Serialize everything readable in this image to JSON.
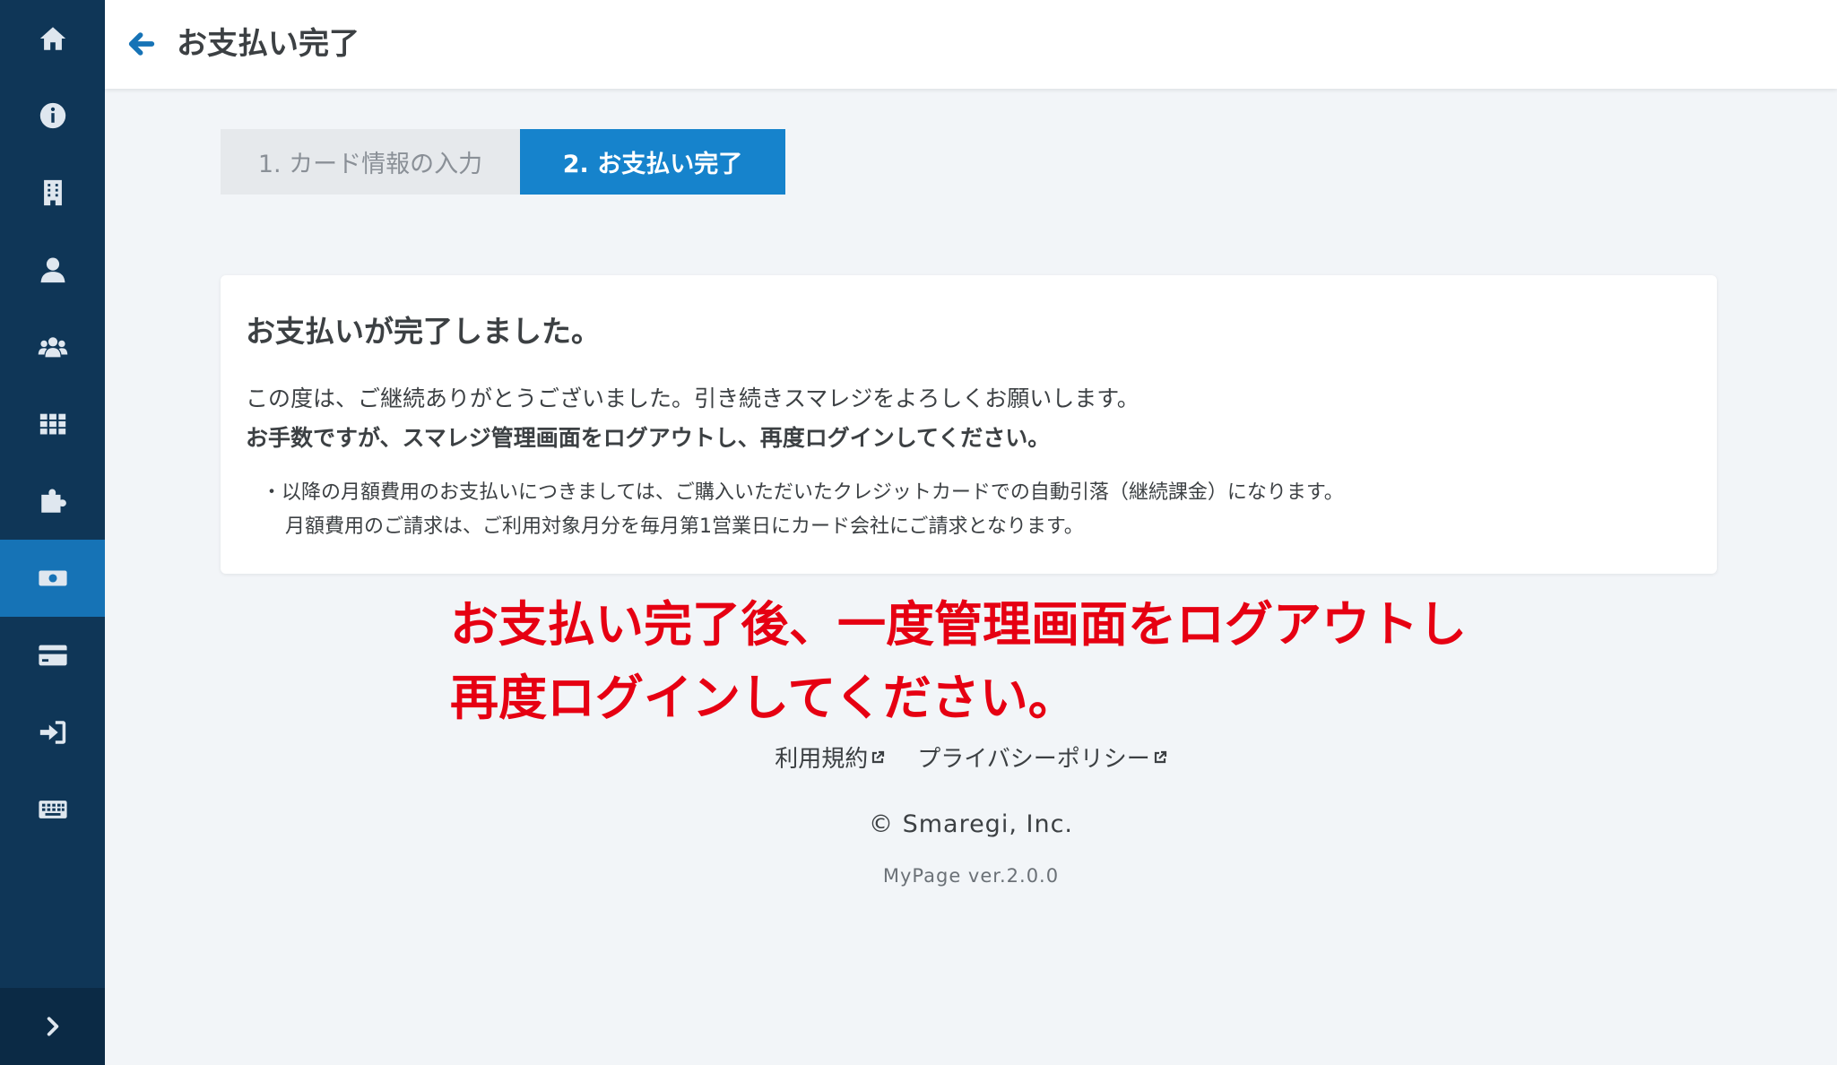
{
  "sidebar": {
    "items": [
      {
        "icon": "home-icon"
      },
      {
        "icon": "info-icon"
      },
      {
        "icon": "building-icon"
      },
      {
        "icon": "user-icon"
      },
      {
        "icon": "users-icon"
      },
      {
        "icon": "apps-grid-icon"
      },
      {
        "icon": "puzzle-icon"
      },
      {
        "icon": "money-icon",
        "active": true
      },
      {
        "icon": "credit-card-icon"
      },
      {
        "icon": "sign-in-icon"
      },
      {
        "icon": "keyboard-icon"
      }
    ],
    "expand_icon": "chevron-right-icon"
  },
  "header": {
    "title": "お支払い完了"
  },
  "steps": [
    {
      "label": "1. カード情報の入力",
      "active": false
    },
    {
      "label": "2. お支払い完了",
      "active": true
    }
  ],
  "card": {
    "title": "お支払いが完了しました。",
    "line1": "この度は、ご継続ありがとうございました。引き続きスマレジをよろしくお願いします。",
    "line2": "お手数ですが、スマレジ管理画面をログアウトし、再度ログインしてください。",
    "note1": "・以降の月額費用のお支払いにつきましては、ご購入いただいたクレジットカードでの自動引落（継続課金）になります。",
    "note2": "月額費用のご請求は、ご利用対象月分を毎月第1営業日にカード会社にご請求となります。"
  },
  "annotation": {
    "line1": "お支払い完了後、一度管理画面をログアウトし",
    "line2": "再度ログインしてください。",
    "color": "#e60012"
  },
  "footer": {
    "terms": "利用規約",
    "privacy": "プライバシーポリシー",
    "copyright": "© Smaregi, Inc.",
    "version": "MyPage ver.2.0.0"
  },
  "colors": {
    "sidebar": "#0f3657",
    "accent": "#1683cc"
  }
}
